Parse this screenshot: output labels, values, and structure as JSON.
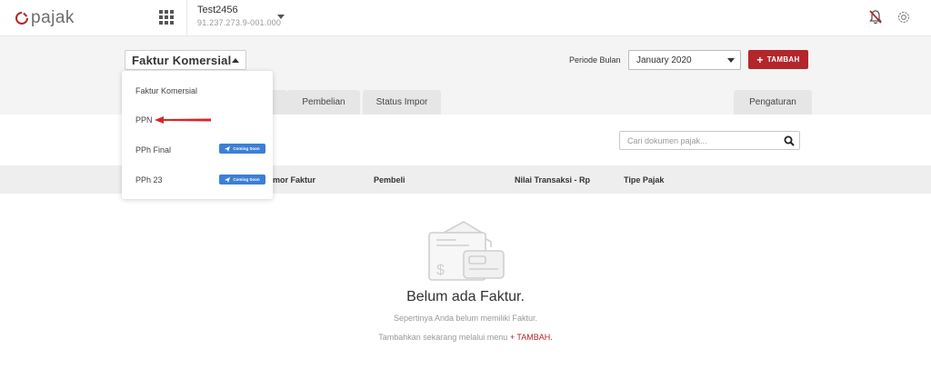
{
  "header": {
    "logo_text": "pajak",
    "company_name": "Test2456",
    "company_npwp": "91.237.273.9-001.000"
  },
  "toolbar": {
    "faktur_select_label": "Faktur Komersial",
    "periode_label": "Periode Bulan",
    "periode_value": "January  2020",
    "tambah_label": "TAMBAH",
    "tambah_plus": "+"
  },
  "tabs": [
    {
      "label": ""
    },
    {
      "label": "Pembelian"
    },
    {
      "label": "Status Impor"
    },
    {
      "label": "Pengaturan"
    }
  ],
  "search": {
    "placeholder": "Cari dokumen pajak..."
  },
  "table": {
    "columns": [
      "mor Faktur",
      "Pembeli",
      "Nilai Transaksi - Rp",
      "Tipe Pajak"
    ]
  },
  "empty_state": {
    "title": "Belum ada Faktur.",
    "subtitle": "Sepertinya Anda belum memiliki Faktur.",
    "cta_text": "Tambahkan sekarang melalui menu ",
    "cta_link": "+ TAMBAH."
  },
  "dropdown": {
    "items": [
      {
        "label": "Faktur Komersial",
        "badge": ""
      },
      {
        "label": "PPN",
        "badge": ""
      },
      {
        "label": "PPh Final",
        "badge": "Coming Soon"
      },
      {
        "label": "PPh 23",
        "badge": "Coming Soon"
      }
    ]
  },
  "colors": {
    "brand_red": "#b3262b",
    "badge_blue": "#3c7fd6",
    "band_gray": "#f4f4f4"
  }
}
